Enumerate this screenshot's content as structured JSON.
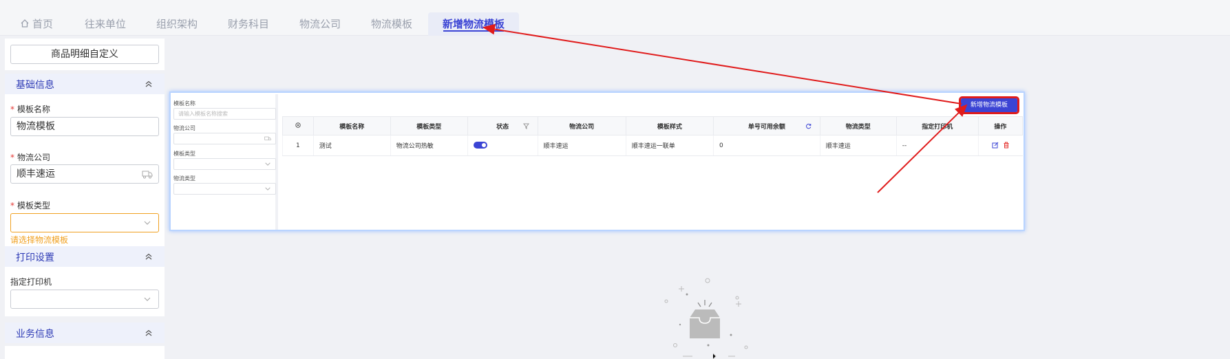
{
  "tabs": [
    {
      "label": "首页",
      "icon": "home-icon"
    },
    {
      "label": "往来单位"
    },
    {
      "label": "组织架构"
    },
    {
      "label": "财务科目"
    },
    {
      "label": "物流公司"
    },
    {
      "label": "物流模板"
    },
    {
      "label": "新增物流模板",
      "active": true
    }
  ],
  "left_panel": {
    "custom_button": "商品明细自定义",
    "sections": {
      "basic": "基础信息",
      "print": "打印设置",
      "business": "业务信息"
    },
    "fields": {
      "template_name": {
        "label": "模板名称",
        "required": true,
        "value": "物流模板"
      },
      "logistics_company": {
        "label": "物流公司",
        "required": true,
        "value": "顺丰速运",
        "icon": "truck-icon"
      },
      "template_type": {
        "label": "模板类型",
        "required": true,
        "value": "",
        "error": "请选择物流模板"
      },
      "printer": {
        "label": "指定打印机",
        "value": ""
      }
    },
    "required_mark": "*"
  },
  "filter": {
    "template_name_label": "模板名称",
    "template_name_placeholder": "请输入模板名称搜索",
    "company_label": "物流公司",
    "type_label": "模板类型",
    "logistics_type_label": "物流类型"
  },
  "add_button": "新增物流模板",
  "table": {
    "columns": [
      "",
      "模板名称",
      "模板类型",
      "状态",
      "物流公司",
      "模板样式",
      "单号可用余额",
      "物流类型",
      "指定打印机",
      "操作"
    ],
    "rows": [
      {
        "index": "1",
        "name": "测试",
        "type": "物流公司热敏",
        "status_on": true,
        "company": "顺丰速运",
        "style": "顺丰速运一联单",
        "balance": "0",
        "logistics_type": "顺丰速运",
        "printer": "--"
      }
    ]
  },
  "colors": {
    "accent": "#3b44d4",
    "annotation": "#e01b1b",
    "warning": "#f0a020"
  }
}
